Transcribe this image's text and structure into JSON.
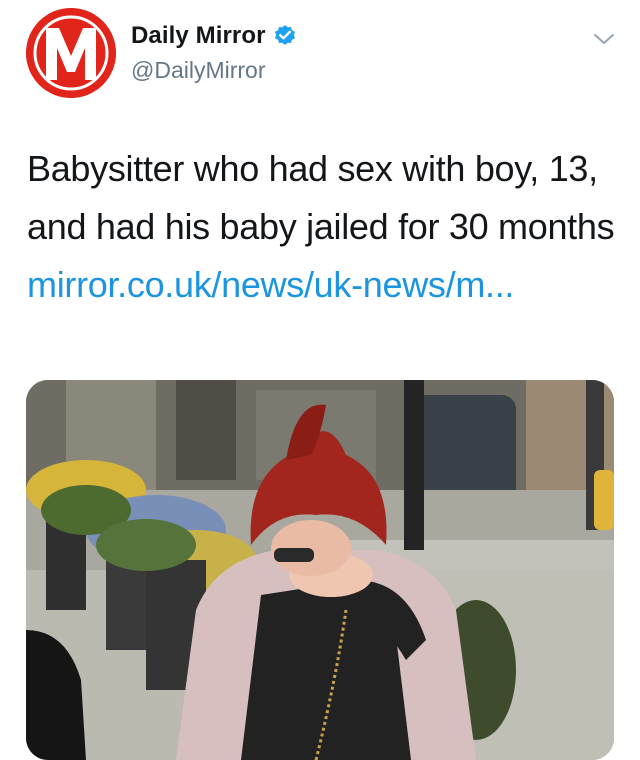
{
  "tweet": {
    "author": {
      "display_name": "Daily Mirror",
      "handle": "@DailyMirror",
      "verified": true,
      "avatar_letter": "M",
      "avatar_color": "#e1251b",
      "verified_color": "#1da1f2"
    },
    "text": "Babysitter who had sex with boy, 13, and had his baby jailed for 30 months",
    "link_text": "mirror.co.uk/news/uk-news/m...",
    "link_color": "#1b95e0",
    "menu_icon": "chevron-down-icon",
    "media": {
      "kind": "photo"
    }
  }
}
